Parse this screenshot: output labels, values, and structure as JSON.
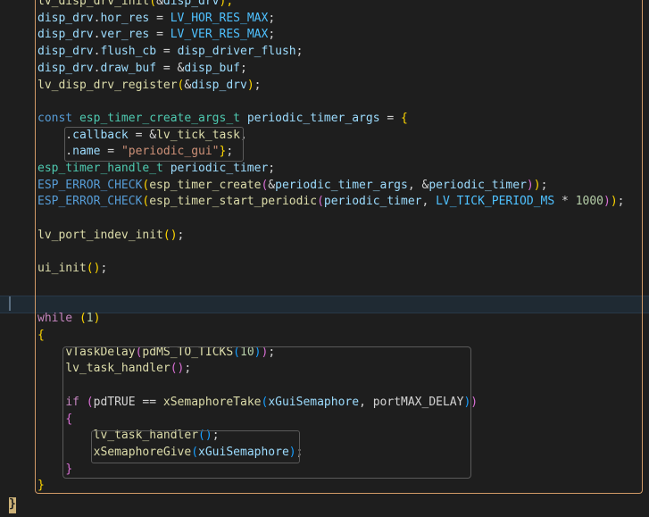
{
  "colors": {
    "background": "#1e1e1e",
    "default": "#d4d4d4",
    "variable": "#9cdcfe",
    "function": "#dcdcaa",
    "type": "#4ec9b0",
    "keyword": "#569cd6",
    "control": "#c586c0",
    "macro": "#569cd6",
    "string": "#ce9178",
    "number": "#b5cea8",
    "constant": "#4fc1ff",
    "bracket1": "#ffd700",
    "bracket2": "#da70d6",
    "bracket3": "#179fff"
  },
  "lines": [
    [
      {
        "t": "lv_disp_drv_init",
        "c": "function"
      },
      {
        "t": "(",
        "c": "bracket1"
      },
      {
        "t": "&",
        "c": "default"
      },
      {
        "t": "disp_drv",
        "c": "variable"
      },
      {
        "t": ");",
        "c": "bracket1"
      }
    ],
    [
      {
        "t": "disp_drv",
        "c": "variable"
      },
      {
        "t": ".",
        "c": "default"
      },
      {
        "t": "hor_res",
        "c": "variable"
      },
      {
        "t": " = ",
        "c": "default"
      },
      {
        "t": "LV_HOR_RES_MAX",
        "c": "constant"
      },
      {
        "t": ";",
        "c": "default"
      }
    ],
    [
      {
        "t": "disp_drv",
        "c": "variable"
      },
      {
        "t": ".",
        "c": "default"
      },
      {
        "t": "ver_res",
        "c": "variable"
      },
      {
        "t": " = ",
        "c": "default"
      },
      {
        "t": "LV_VER_RES_MAX",
        "c": "constant"
      },
      {
        "t": ";",
        "c": "default"
      }
    ],
    [
      {
        "t": "disp_drv",
        "c": "variable"
      },
      {
        "t": ".",
        "c": "default"
      },
      {
        "t": "flush_cb",
        "c": "variable"
      },
      {
        "t": " = ",
        "c": "default"
      },
      {
        "t": "disp_driver_flush",
        "c": "variable"
      },
      {
        "t": ";",
        "c": "default"
      }
    ],
    [
      {
        "t": "disp_drv",
        "c": "variable"
      },
      {
        "t": ".",
        "c": "default"
      },
      {
        "t": "draw_buf",
        "c": "variable"
      },
      {
        "t": " = &",
        "c": "default"
      },
      {
        "t": "disp_buf",
        "c": "variable"
      },
      {
        "t": ";",
        "c": "default"
      }
    ],
    [
      {
        "t": "lv_disp_drv_register",
        "c": "function"
      },
      {
        "t": "(",
        "c": "bracket1"
      },
      {
        "t": "&",
        "c": "default"
      },
      {
        "t": "disp_drv",
        "c": "variable"
      },
      {
        "t": ")",
        "c": "bracket1"
      },
      {
        "t": ";",
        "c": "default"
      }
    ],
    [],
    [
      {
        "t": "const",
        "c": "keyword"
      },
      {
        "t": " ",
        "c": "default"
      },
      {
        "t": "esp_timer_create_args_t",
        "c": "type"
      },
      {
        "t": " ",
        "c": "default"
      },
      {
        "t": "periodic_timer_args",
        "c": "variable"
      },
      {
        "t": " = ",
        "c": "default"
      },
      {
        "t": "{",
        "c": "bracket1"
      }
    ],
    [
      {
        "t": "    .",
        "c": "default"
      },
      {
        "t": "callback",
        "c": "variable"
      },
      {
        "t": " = &",
        "c": "default"
      },
      {
        "t": "lv_tick_task",
        "c": "function"
      },
      {
        "t": ",",
        "c": "default"
      }
    ],
    [
      {
        "t": "    .",
        "c": "default"
      },
      {
        "t": "name",
        "c": "variable"
      },
      {
        "t": " = ",
        "c": "default"
      },
      {
        "t": "\"periodic_gui\"",
        "c": "string"
      },
      {
        "t": "}",
        "c": "bracket1"
      },
      {
        "t": ";",
        "c": "default"
      }
    ],
    [
      {
        "t": "esp_timer_handle_t",
        "c": "type"
      },
      {
        "t": " ",
        "c": "default"
      },
      {
        "t": "periodic_timer",
        "c": "variable"
      },
      {
        "t": ";",
        "c": "default"
      }
    ],
    [
      {
        "t": "ESP_ERROR_CHECK",
        "c": "macro"
      },
      {
        "t": "(",
        "c": "bracket1"
      },
      {
        "t": "esp_timer_create",
        "c": "function"
      },
      {
        "t": "(",
        "c": "bracket2"
      },
      {
        "t": "&",
        "c": "default"
      },
      {
        "t": "periodic_timer_args",
        "c": "variable"
      },
      {
        "t": ", &",
        "c": "default"
      },
      {
        "t": "periodic_timer",
        "c": "variable"
      },
      {
        "t": ")",
        "c": "bracket2"
      },
      {
        "t": ")",
        "c": "bracket1"
      },
      {
        "t": ";",
        "c": "default"
      }
    ],
    [
      {
        "t": "ESP_ERROR_CHECK",
        "c": "macro"
      },
      {
        "t": "(",
        "c": "bracket1"
      },
      {
        "t": "esp_timer_start_periodic",
        "c": "function"
      },
      {
        "t": "(",
        "c": "bracket2"
      },
      {
        "t": "periodic_timer",
        "c": "variable"
      },
      {
        "t": ", ",
        "c": "default"
      },
      {
        "t": "LV_TICK_PERIOD_MS",
        "c": "constant"
      },
      {
        "t": " * ",
        "c": "default"
      },
      {
        "t": "1000",
        "c": "number"
      },
      {
        "t": ")",
        "c": "bracket2"
      },
      {
        "t": ")",
        "c": "bracket1"
      },
      {
        "t": ";",
        "c": "default"
      }
    ],
    [],
    [
      {
        "t": "lv_port_indev_init",
        "c": "function"
      },
      {
        "t": "()",
        "c": "bracket1"
      },
      {
        "t": ";",
        "c": "default"
      }
    ],
    [],
    [
      {
        "t": "ui_init",
        "c": "function"
      },
      {
        "t": "()",
        "c": "bracket1"
      },
      {
        "t": ";",
        "c": "default"
      }
    ],
    [],
    [],
    [
      {
        "t": "while",
        "c": "control"
      },
      {
        "t": " ",
        "c": "default"
      },
      {
        "t": "(",
        "c": "bracket1"
      },
      {
        "t": "1",
        "c": "number"
      },
      {
        "t": ")",
        "c": "bracket1"
      }
    ],
    [
      {
        "t": "{",
        "c": "bracket1"
      }
    ],
    [
      {
        "t": "    ",
        "c": "default"
      },
      {
        "t": "vTaskDelay",
        "c": "function"
      },
      {
        "t": "(",
        "c": "bracket2"
      },
      {
        "t": "pdMS_TO_TICKS",
        "c": "function"
      },
      {
        "t": "(",
        "c": "bracket3"
      },
      {
        "t": "10",
        "c": "number"
      },
      {
        "t": ")",
        "c": "bracket3"
      },
      {
        "t": ")",
        "c": "bracket2"
      },
      {
        "t": ";",
        "c": "default"
      }
    ],
    [
      {
        "t": "    ",
        "c": "default"
      },
      {
        "t": "lv_task_handler",
        "c": "function"
      },
      {
        "t": "()",
        "c": "bracket2"
      },
      {
        "t": ";",
        "c": "default"
      }
    ],
    [],
    [
      {
        "t": "    ",
        "c": "default"
      },
      {
        "t": "if",
        "c": "control"
      },
      {
        "t": " ",
        "c": "default"
      },
      {
        "t": "(",
        "c": "bracket2"
      },
      {
        "t": "pdTRUE",
        "c": "default"
      },
      {
        "t": " == ",
        "c": "default"
      },
      {
        "t": "xSemaphoreTake",
        "c": "function"
      },
      {
        "t": "(",
        "c": "bracket3"
      },
      {
        "t": "xGuiSemaphore",
        "c": "variable"
      },
      {
        "t": ", ",
        "c": "default"
      },
      {
        "t": "portMAX_DELAY",
        "c": "default"
      },
      {
        "t": ")",
        "c": "bracket3"
      },
      {
        "t": ")",
        "c": "bracket2"
      }
    ],
    [
      {
        "t": "    ",
        "c": "default"
      },
      {
        "t": "{",
        "c": "bracket2"
      }
    ],
    [
      {
        "t": "        ",
        "c": "default"
      },
      {
        "t": "lv_task_handler",
        "c": "function"
      },
      {
        "t": "()",
        "c": "bracket3"
      },
      {
        "t": ";",
        "c": "default"
      }
    ],
    [
      {
        "t": "        ",
        "c": "default"
      },
      {
        "t": "xSemaphoreGive",
        "c": "function"
      },
      {
        "t": "(",
        "c": "bracket3"
      },
      {
        "t": "xGuiSemaphore",
        "c": "variable"
      },
      {
        "t": ")",
        "c": "bracket3"
      },
      {
        "t": ";",
        "c": "default"
      }
    ],
    [
      {
        "t": "    ",
        "c": "default"
      },
      {
        "t": "}",
        "c": "bracket2"
      }
    ],
    [
      {
        "t": "}",
        "c": "bracket1"
      }
    ]
  ],
  "outer_closing_brace": "}"
}
